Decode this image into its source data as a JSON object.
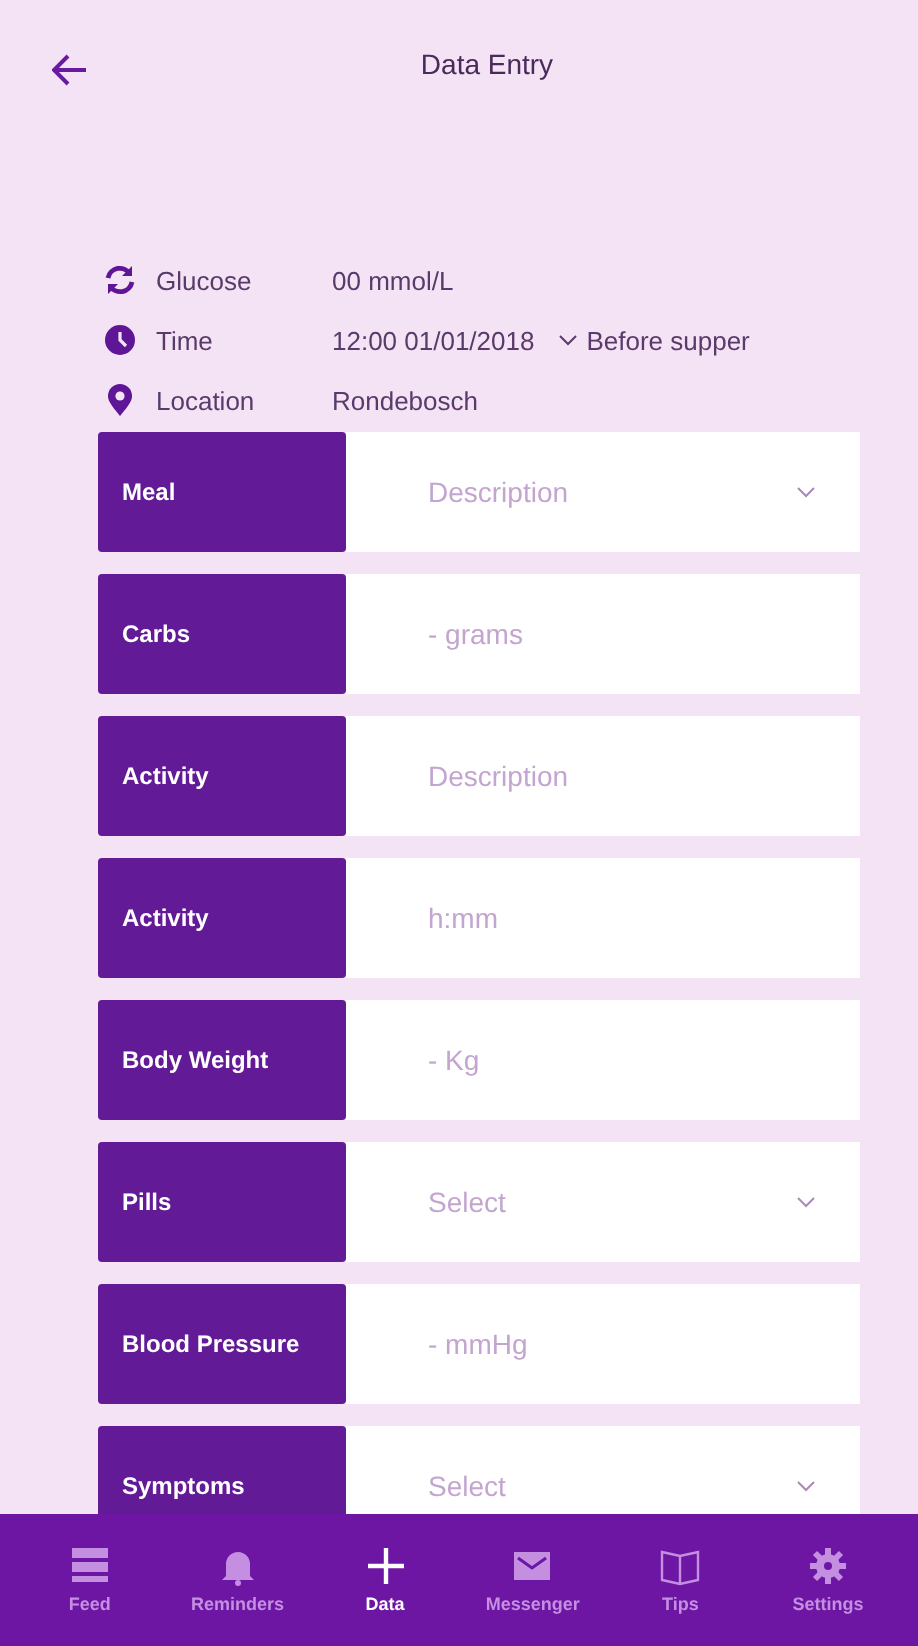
{
  "header": {
    "title": "Data Entry"
  },
  "info": [
    {
      "kind": "refresh",
      "label": "Glucose",
      "value": "00 mmol/L"
    },
    {
      "kind": "clock",
      "label": "Time",
      "value": "12:00 01/01/2018",
      "extra": "Before supper"
    },
    {
      "kind": "pin",
      "label": "Location",
      "value": "Rondebosch"
    }
  ],
  "fields": [
    {
      "label": "Meal",
      "placeholder": "Description",
      "kind": "dropdown"
    },
    {
      "label": "Carbs",
      "placeholder": "- grams",
      "kind": "input"
    },
    {
      "label": "Activity",
      "placeholder": "Description",
      "kind": "input"
    },
    {
      "label": "Activity",
      "placeholder": "h:mm",
      "kind": "input"
    },
    {
      "label": "Body Weight",
      "placeholder": "- Kg",
      "kind": "input"
    },
    {
      "label": "Pills",
      "placeholder": "Select",
      "kind": "dropdown"
    },
    {
      "label": "Blood Pressure",
      "placeholder": "- mmHg",
      "kind": "input"
    },
    {
      "label": "Symptoms",
      "placeholder": "Select",
      "kind": "dropdown"
    }
  ],
  "nav": [
    {
      "kind": "feed",
      "label": "Feed",
      "selected": false
    },
    {
      "kind": "bell",
      "label": "Reminders",
      "selected": false
    },
    {
      "kind": "plus",
      "label": "Data",
      "selected": true
    },
    {
      "kind": "mail",
      "label": "Messenger",
      "selected": false
    },
    {
      "kind": "book",
      "label": "Tips",
      "selected": false
    },
    {
      "kind": "gear",
      "label": "Settings",
      "selected": false
    }
  ]
}
